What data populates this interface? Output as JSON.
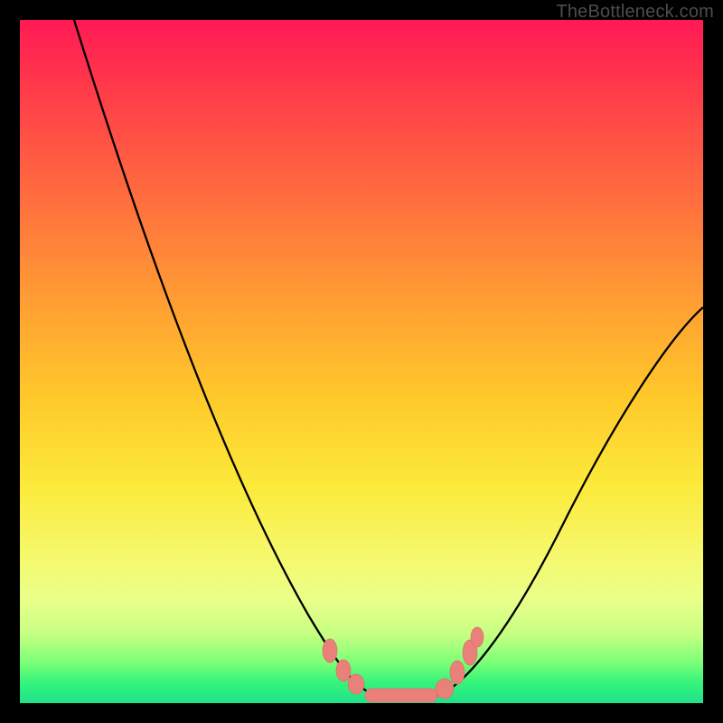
{
  "watermark": {
    "text": "TheBottleneck.com"
  },
  "chart_data": {
    "type": "line",
    "title": "",
    "xlabel": "",
    "ylabel": "",
    "xlim": [
      0,
      100
    ],
    "ylim": [
      0,
      100
    ],
    "grid": false,
    "background": {
      "gradient_top_color": "#ff1a55",
      "gradient_bottom_color": "#1fe28a"
    },
    "series": [
      {
        "name": "bottleneck-curve",
        "color": "#000000",
        "x": [
          8,
          12,
          16,
          20,
          24,
          28,
          32,
          36,
          40,
          44,
          48,
          50,
          52,
          54,
          56,
          58,
          60,
          64,
          68,
          72,
          76,
          80,
          84,
          88,
          92,
          96,
          100
        ],
        "y": [
          100,
          90,
          80,
          70,
          61,
          52,
          44,
          36,
          29,
          22,
          15,
          10,
          5,
          2,
          1,
          1,
          1,
          2,
          6,
          12,
          19,
          26,
          33,
          40,
          47,
          53,
          58
        ]
      }
    ],
    "markers": [
      {
        "name": "flat-region-markers",
        "color": "#e98079",
        "x": [
          46,
          48,
          50,
          52,
          54,
          56,
          58,
          60,
          62,
          64
        ],
        "y": [
          14,
          10,
          5,
          2,
          1,
          1,
          1,
          1,
          4,
          9
        ]
      }
    ]
  }
}
